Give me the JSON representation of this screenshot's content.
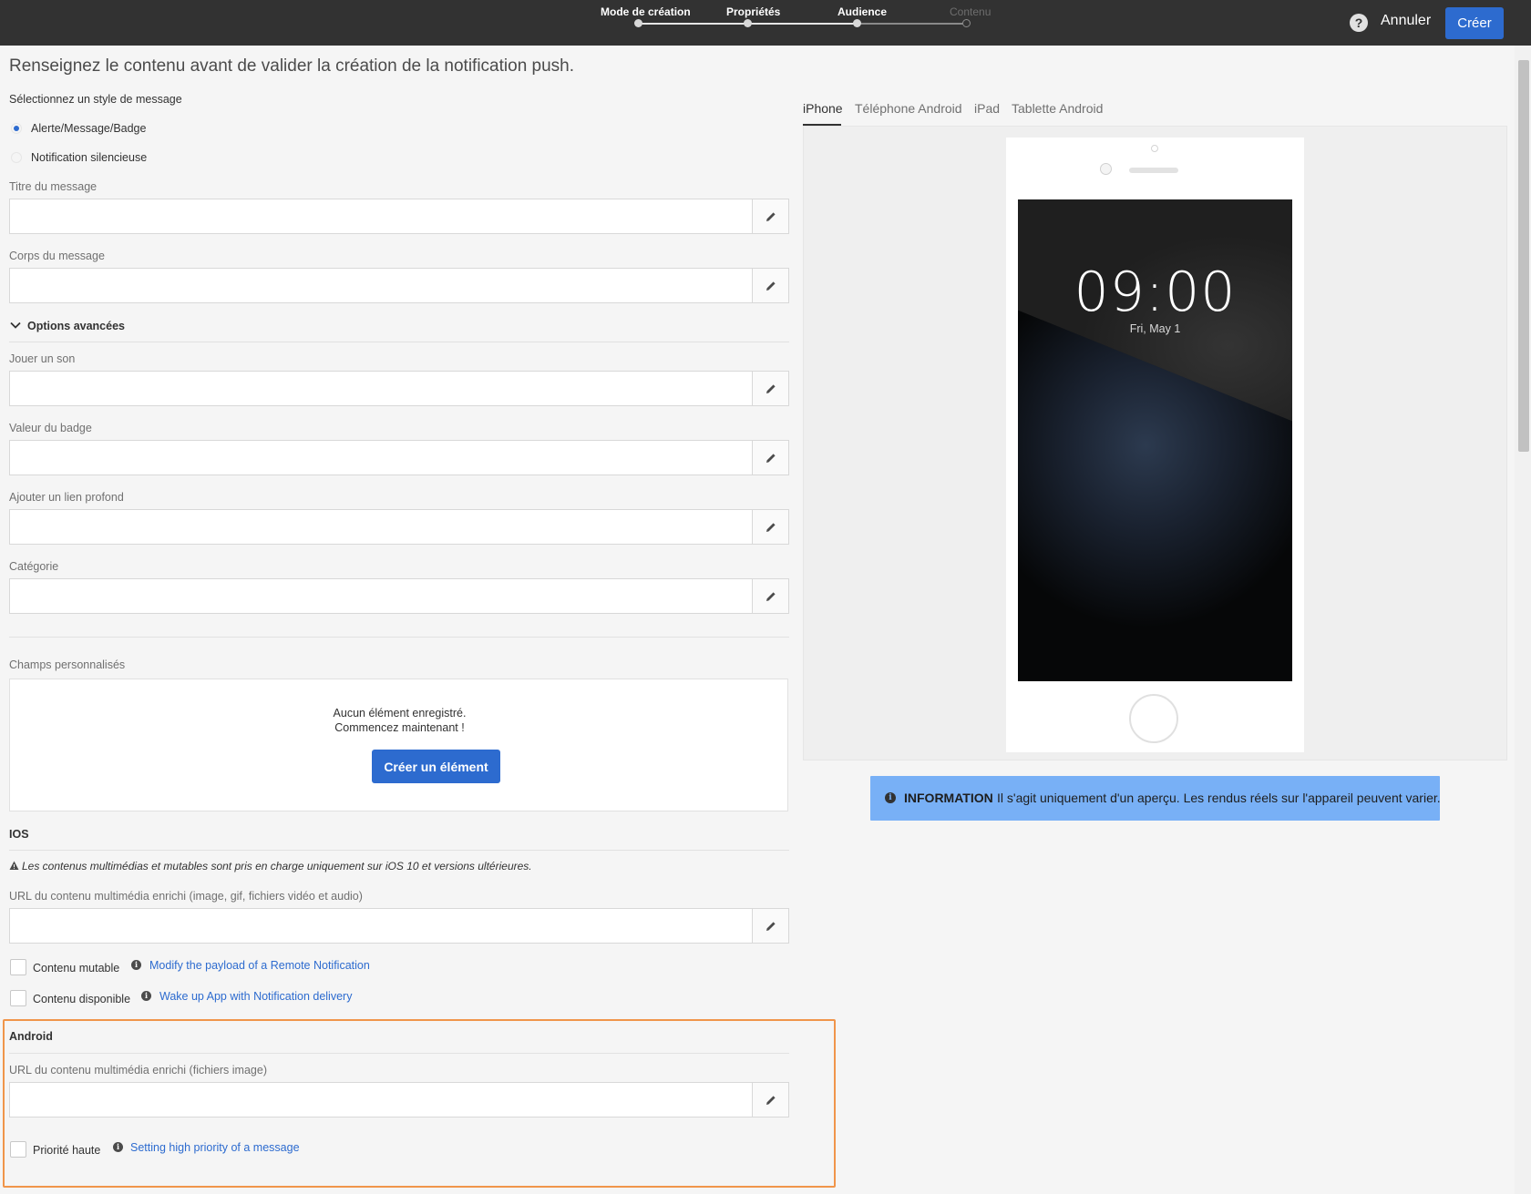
{
  "header": {
    "steps": [
      {
        "label": "Mode de création",
        "state": "done"
      },
      {
        "label": "Propriétés",
        "state": "done"
      },
      {
        "label": "Audience",
        "state": "done"
      },
      {
        "label": "Contenu",
        "state": "current"
      }
    ],
    "help_icon": "question-mark-icon",
    "cancel_label": "Annuler",
    "create_label": "Créer"
  },
  "form": {
    "page_title": "Renseignez le contenu avant de valider la création de la notification push.",
    "style_label": "Sélectionnez un style de message",
    "style_options": [
      {
        "label": "Alerte/Message/Badge",
        "selected": true
      },
      {
        "label": "Notification silencieuse",
        "selected": false
      }
    ],
    "message_title_label": "Titre du message",
    "message_title_value": "",
    "message_body_label": "Corps du message",
    "message_body_value": "",
    "advanced_label": "Options avancées",
    "sound_label": "Jouer un son",
    "sound_value": "",
    "badge_label": "Valeur du badge",
    "badge_value": "",
    "deeplink_label": "Ajouter un lien profond",
    "deeplink_value": "",
    "category_label": "Catégorie",
    "category_value": "",
    "custom_fields_label": "Champs personnalisés",
    "empty_line1": "Aucun élément enregistré.",
    "empty_line2": "Commencez maintenant !",
    "create_element_label": "Créer un élément",
    "ios": {
      "heading": "IOS",
      "warning": "Les contenus multimédias et mutables sont pris en charge uniquement sur iOS 10 et versions ultérieures.",
      "media_url_label": "URL du contenu multimédia enrichi (image, gif, fichiers vidéo et audio)",
      "media_url_value": "",
      "mutable_label": "Contenu mutable",
      "mutable_checked": false,
      "mutable_link": "Modify the payload of a Remote Notification",
      "available_label": "Contenu disponible",
      "available_checked": false,
      "available_link": "Wake up App with Notification delivery"
    },
    "android": {
      "heading": "Android",
      "media_url_label": "URL du contenu multimédia enrichi (fichiers image)",
      "media_url_value": "",
      "priority_label": "Priorité haute",
      "priority_checked": false,
      "priority_link": "Setting high priority of a message"
    },
    "highlight_color": "#f0954a"
  },
  "preview": {
    "tabs": [
      {
        "label": "iPhone",
        "active": true
      },
      {
        "label": "Téléphone Android",
        "active": false
      },
      {
        "label": "iPad",
        "active": false
      },
      {
        "label": "Tablette Android",
        "active": false
      }
    ],
    "clock": "09:00",
    "date": "Fri, May 1",
    "info_title": "INFORMATION",
    "info_text": "Il s'agit uniquement d'un aperçu. Les rendus réels sur l'appareil peuvent varier."
  },
  "colors": {
    "accent": "#2d6bcf",
    "topbar": "#323232",
    "info_banner": "#78b0f6"
  }
}
